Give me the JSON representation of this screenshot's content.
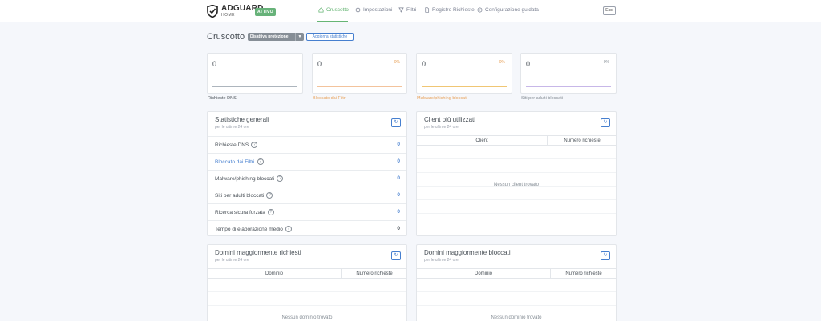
{
  "header": {
    "logo_title": "ADGUARD",
    "logo_sub": "HOME",
    "status_badge": "ATTIVO",
    "nav": [
      {
        "label": "Cruscotto",
        "icon": "home-icon"
      },
      {
        "label": "Impostazioni",
        "icon": "gear-icon"
      },
      {
        "label": "Filtri",
        "icon": "filter-icon"
      },
      {
        "label": "Registro Richieste",
        "icon": "document-icon"
      },
      {
        "label": "Configurazione guidata",
        "icon": "help-circle-icon"
      }
    ],
    "exit_label": "Esci"
  },
  "dashboard": {
    "title": "Cruscotto",
    "disable_protection": "Disattiva protezione",
    "update_stats": "Aggiorna statistiche"
  },
  "summary": [
    {
      "value": "0",
      "percent": "",
      "label": "Richieste DNS",
      "color": "#495057",
      "line_color": "#adb5bd"
    },
    {
      "value": "0",
      "percent": "0%",
      "label": "Bloccato dai Filtri",
      "color": "#e8a35c",
      "line_color": "#f3c39c"
    },
    {
      "value": "0",
      "percent": "0%",
      "label": "Malware/phishing bloccati",
      "color": "#e8a35c",
      "line_color": "#f0c674"
    },
    {
      "value": "0",
      "percent": "0%",
      "label": "Siti per adulti bloccati",
      "color": "#868e96",
      "line_color": "#c7b7e8"
    }
  ],
  "general_stats": {
    "title": "Statistiche generali",
    "subtitle": "per le ultime 24 ore",
    "rows": [
      {
        "label": "Richieste DNS",
        "value": "0"
      },
      {
        "label": "Bloccato dai Filtri",
        "value": "0"
      },
      {
        "label": "Malware/phishing bloccati",
        "value": "0"
      },
      {
        "label": "Siti per adulti bloccati",
        "value": "0"
      },
      {
        "label": "Ricerca sicura forzata",
        "value": "0"
      },
      {
        "label": "Tempo di elaborazione medio",
        "value": "0"
      }
    ]
  },
  "top_clients": {
    "title": "Client più utilizzati",
    "subtitle": "per le ultime 24 ore",
    "col_client": "Client",
    "col_requests": "Numero richieste",
    "empty": "Nessun client trovato"
  },
  "top_queried": {
    "title": "Domini maggiormente richiesti",
    "subtitle": "per le ultime 24 ore",
    "col_domain": "Dominio",
    "col_requests": "Numero richieste",
    "empty": "Nessun dominio trovato"
  },
  "top_blocked": {
    "title": "Domini maggiormente bloccati",
    "subtitle": "per le ultime 24 ore",
    "col_domain": "Dominio",
    "col_requests": "Numero richieste",
    "empty": "Nessun dominio trovato"
  },
  "colors": {
    "accent_green": "#66b574",
    "link_blue": "#467fcf",
    "orange": "#e8a35c"
  }
}
